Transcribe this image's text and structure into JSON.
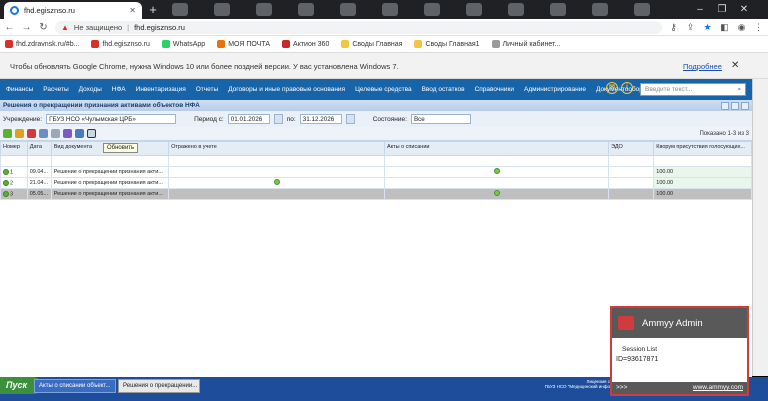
{
  "browser": {
    "tab_title": "fhd.egisznso.ru",
    "url_security": "Не защищено",
    "url": "fhd.egisznso.ru",
    "bookmarks": [
      {
        "label": "fhd.zdravnsk.ru/#b...",
        "color": "#d93025"
      },
      {
        "label": "fhd.egisznso.ru",
        "color": "#d93025"
      },
      {
        "label": "WhatsApp",
        "color": "#25d366"
      },
      {
        "label": "МОЯ ПОЧТА",
        "color": "#e8710a"
      },
      {
        "label": "Актион 360",
        "color": "#c62828"
      },
      {
        "label": "Своды Главная",
        "color": "#f4c542"
      },
      {
        "label": "Своды Главная1",
        "color": "#f4c542"
      },
      {
        "label": "Личный кабинет...",
        "color": "#999999"
      }
    ],
    "info_message": "Чтобы обновлять Google Chrome, нужна Windows 10 или более поздней версии. У вас установлена Windows 7.",
    "info_link": "Подробнее",
    "close_glyph": "✕"
  },
  "app": {
    "nav": [
      "Финансы",
      "Расчеты",
      "Доходы",
      "НФА",
      "Инвентаризация",
      "Отчеты",
      "Договоры и иные правовые основания",
      "Целевые средства",
      "Ввод остатков",
      "Справочники",
      "Администрирование",
      "Документооборот"
    ],
    "search_placeholder": "Введите текст...",
    "panel_title": "Решения о прекращении признания активами объектов НФА",
    "filters": {
      "institution_label": "Учреждение:",
      "institution_value": "ГБУЗ НСО «Чулымская ЦРБ»",
      "period_from_label": "Период с:",
      "period_from": "01.01.2026",
      "period_to_label": "по:",
      "period_to": "31.12.2026",
      "state_label": "Состояние:",
      "state_value": "Все"
    },
    "shown_text": "Показано 1-3 из 3",
    "tooltip": "Обновить",
    "columns": [
      "Номер",
      "Дата",
      "Вид документа",
      "Отражено в учете",
      "Акты о списании",
      "ЭДО",
      "Кворум присутствия голосующих..."
    ],
    "rows": [
      {
        "num": "1",
        "date": "09.04...",
        "type": "Решение о прекращении признания акти...",
        "reflected": false,
        "acts": true,
        "kv": "100.00"
      },
      {
        "num": "2",
        "date": "21.04...",
        "type": "Решение о прекращении признания акти...",
        "reflected": true,
        "acts": false,
        "kv": "100.00"
      },
      {
        "num": "3",
        "date": "05.05...",
        "type": "Решение о прекращении признания акти...",
        "reflected": false,
        "acts": true,
        "kv": "100.00"
      }
    ]
  },
  "taskbar": {
    "start": "Пуск",
    "tasks": [
      "Акты о списании объект...",
      "Решения о прекращении..."
    ],
    "tray_line1": "Лицензия с",
    "tray_line2": "ГБУЗ НСО \"Медицинский инфо"
  },
  "ammyy": {
    "title": "Ammyy Admin",
    "session_list": "Session List",
    "id": "ID=93617871",
    "foot_left": ">>>",
    "foot_link": "www.ammyy.com"
  }
}
